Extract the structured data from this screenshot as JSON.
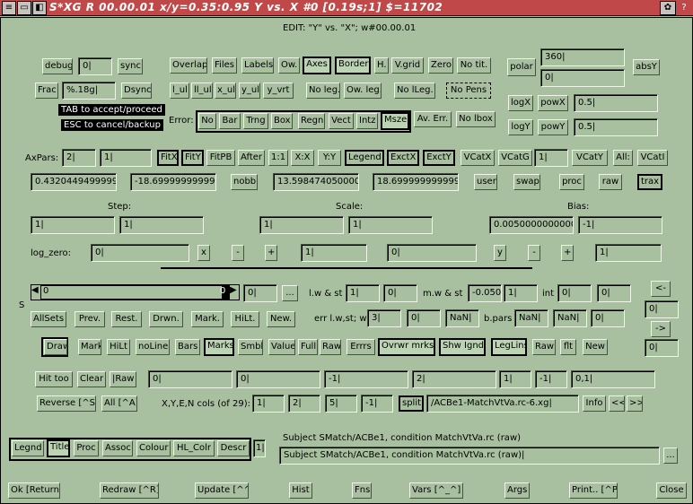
{
  "title": "S*XG R 00.00.01 x/y=0.35:0.95  Y vs. X #0  [0.19s;1] $=11702",
  "tb": {
    "sys": "≡",
    "min": "▭",
    "max": "◧",
    "help": "?"
  },
  "edit_label": "EDIT:   \"Y\" vs. \"X\"; w#00.00.01",
  "r1": {
    "debug": "debug",
    "debug_val": "0|",
    "sync": "sync",
    "frac": "Frac",
    "frac_fmt": "%.18g|",
    "dsync": "Dsync"
  },
  "tips": {
    "tab": "TAB to accept/proceed",
    "esc": "ESC to cancel/backup"
  },
  "opt1": [
    "Overlap",
    "Files",
    "Labels",
    "Ow.",
    "Axes",
    "Border",
    "H.",
    "V.grid",
    "Zero",
    "No tit."
  ],
  "opt2": [
    "l_ul",
    "ll_ul",
    "x_ul",
    "y_ul",
    "y_vrt",
    "No leg.",
    "Ow. leg.",
    "No lLeg.",
    "No Pens"
  ],
  "err": {
    "label": "Error:",
    "btns": [
      "No",
      "Bar",
      "Trng",
      "Box",
      "Regn",
      "Vect",
      "Intz",
      "Msze"
    ],
    "av": "Av. Err.",
    "nobox": "No lbox"
  },
  "polar": {
    "label": "polar",
    "v1": "360|",
    "v2": "0|",
    "absy": "absY"
  },
  "logs": {
    "logx": "logX",
    "powx": "powX",
    "vx": "0.5|",
    "logy": "logY",
    "powy": "powY",
    "vy": "0.5|"
  },
  "ax": {
    "label": "AxPars:",
    "v1": "2|",
    "v2": "1|",
    "btns": [
      "FitX",
      "FitY",
      "FitPB",
      "After",
      "1:1",
      "X:X",
      "Y:Y",
      "Legend",
      "ExctX",
      "ExctY",
      "VCatX",
      "VCatG"
    ],
    "vcat_val": "1|",
    "vcaty": "VCatY",
    "all": "All:",
    "vcatl": "VCatI"
  },
  "vals": {
    "v1": "0.43204494999999",
    "v2": "-18.699999999999",
    "nobb": "nobb",
    "v3": "13.598474050000",
    "v4": "18.699999999999",
    "user": "user",
    "swap": "swap",
    "proc": "proc",
    "raw": "raw",
    "trax": "trax"
  },
  "hdr": {
    "step": "Step:",
    "scale": "Scale:",
    "bias": "Bias:"
  },
  "sbs": {
    "s1": "1|",
    "s2": "1|",
    "c1": "1|",
    "c2": "1|",
    "b1": "0.0050000000000",
    "b2": "-1|"
  },
  "lz": {
    "label": "log_zero:",
    "v1": "0|",
    "x": "x",
    "m1": "-",
    "p1": "+",
    "v2": "1|",
    "v3": "0|",
    "y": "y",
    "m2": "-",
    "p2": "+",
    "v4": "1|"
  },
  "sl": {
    "s": "S",
    "lo": "0",
    "hi": "0",
    "v": "0|",
    "dots": "..."
  },
  "lw": {
    "lw_label": "l.w & st",
    "lw1": "1|",
    "lw2": "0|",
    "mw_label": "m.w & st",
    "mw1": "-0.050",
    "mw2": "1|",
    "int_label": "int",
    "i1": "0|",
    "i2": "0|"
  },
  "nav": {
    "up": "<-",
    "v1": "0|",
    "dn": "->",
    "v2": "0|"
  },
  "sets": [
    "AllSets",
    "Prev.",
    "Rest.",
    "Drwn.",
    "Mark.",
    "HiLt.",
    "New."
  ],
  "erl": {
    "label": "err l.w,st; w",
    "v1": "3|",
    "v2": "0|",
    "v3": "NaN|",
    "bp": "b.pars",
    "v4": "NaN|",
    "v5": "NaN|",
    "v6": "0|"
  },
  "dr": [
    "Draw",
    "Mark",
    "HiLt",
    "noLine",
    "Bars",
    "Marks",
    "Smbl",
    "Value",
    "Full",
    "Raw",
    "Errrs",
    "Ovrwr mrks",
    "Shw Ignd",
    "LegLins",
    "Raw",
    "flt",
    "New"
  ],
  "ht": {
    "hit": "Hit too",
    "clear": "Clear",
    "raw": "|Raw",
    "vals": [
      "0|",
      "0|",
      "-1|",
      "2|",
      "1|",
      "-1|",
      "0,1|"
    ]
  },
  "rev": {
    "rev": "Reverse [^S]",
    "all": "All [^A]",
    "cols": "X,Y,E,N cols (of 29):",
    "vals": [
      "1|",
      "2|",
      "5|",
      "-1|"
    ],
    "split": "split",
    "file": "/ACBe1-MatchVtVa.rc-6.xg|",
    "info": "Info",
    "prev": "<<",
    "next": ">>"
  },
  "tabs": [
    "Legnd",
    "Title",
    "Proc",
    "Assoc",
    "Colour",
    "HL_Colr",
    "Descr"
  ],
  "tabs_field": "1|",
  "subj": {
    "label": "Subject SMatch/ACBe1, condition MatchVtVa.rc (raw)",
    "value": "Subject SMatch/ACBe1, condition MatchVtVa.rc (raw)|",
    "dots": "..."
  },
  "bottom": [
    "Ok [Return]",
    "Redraw [^R]",
    "Update [^^]",
    "Hist",
    "Fns",
    "Vars [^_^]",
    "Args",
    "Print.. [^P]",
    "Close"
  ]
}
